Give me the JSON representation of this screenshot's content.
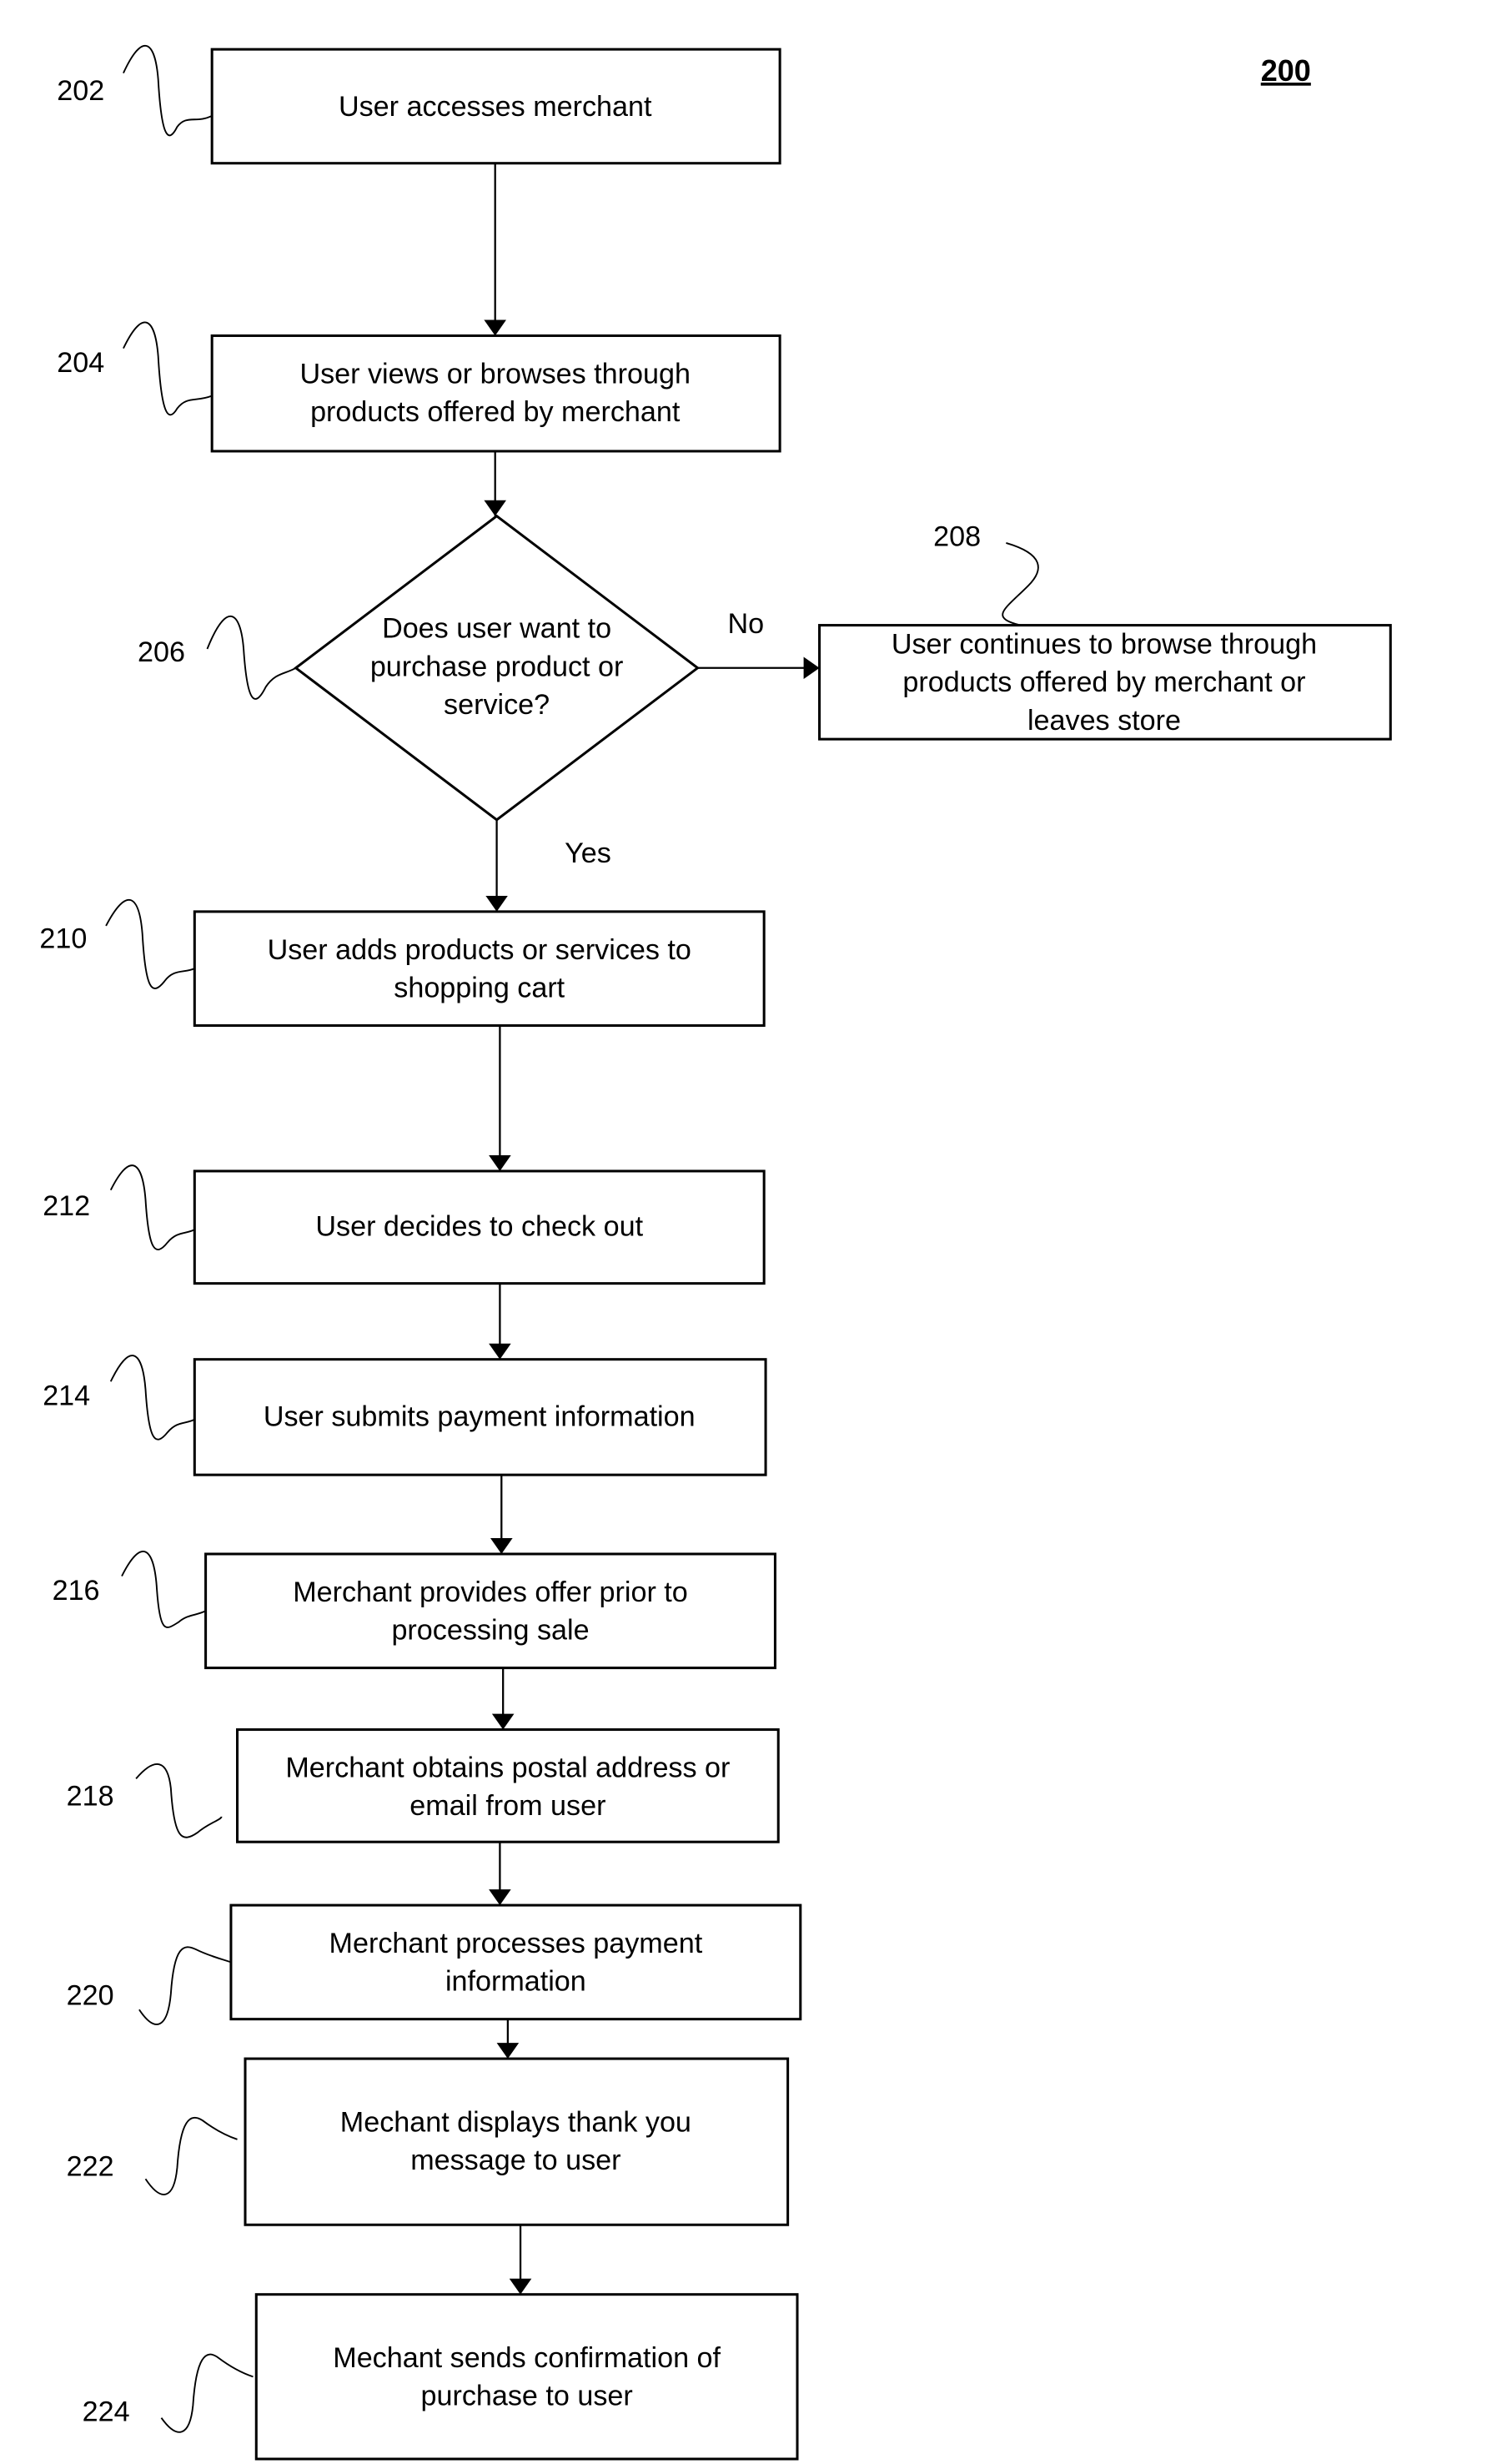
{
  "figure_label": "200",
  "nodes": {
    "n202": {
      "ref": "202",
      "lines": [
        "User accesses merchant"
      ]
    },
    "n204": {
      "ref": "204",
      "lines": [
        "User views or browses through",
        "products offered by merchant"
      ]
    },
    "n206": {
      "ref": "206",
      "lines": [
        "Does user want to",
        "purchase product or",
        "service?"
      ]
    },
    "n208": {
      "ref": "208",
      "lines": [
        "User continues to browse through",
        "products offered by merchant or",
        "leaves store"
      ]
    },
    "n210": {
      "ref": "210",
      "lines": [
        "User adds products or services to",
        "shopping cart"
      ]
    },
    "n212": {
      "ref": "212",
      "lines": [
        "User decides to check out"
      ]
    },
    "n214": {
      "ref": "214",
      "lines": [
        "User submits payment information"
      ]
    },
    "n216": {
      "ref": "216",
      "lines": [
        "Merchant provides offer prior to",
        "processing sale"
      ]
    },
    "n218": {
      "ref": "218",
      "lines": [
        "Merchant obtains postal address or",
        "email from user"
      ]
    },
    "n220": {
      "ref": "220",
      "lines": [
        "Merchant processes payment",
        "information"
      ]
    },
    "n222": {
      "ref": "222",
      "lines": [
        "Mechant displays thank you",
        "message to user"
      ]
    },
    "n224": {
      "ref": "224",
      "lines": [
        "Mechant sends confirmation of",
        "purchase to user"
      ]
    }
  },
  "edge_labels": {
    "no": "No",
    "yes": "Yes"
  }
}
